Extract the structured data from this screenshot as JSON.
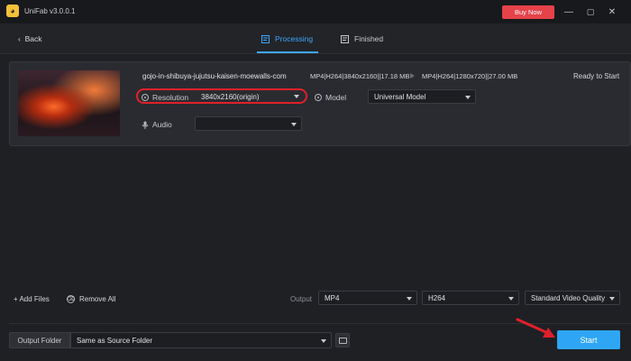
{
  "app": {
    "title": "UniFab v3.0.0.1",
    "buy_label": "Buy Now",
    "minimize": "—",
    "maximize": "▢",
    "close": "✕"
  },
  "nav": {
    "back_label": "Back",
    "tabs": [
      {
        "label": "Processing",
        "active": true
      },
      {
        "label": "Finished",
        "active": false
      }
    ]
  },
  "file": {
    "name": "gojo-in-shibuya-jujutsu-kaisen-moewalls-com",
    "input_spec": "MP4|H264|3840x2160||17.18 MB",
    "output_spec": "MP4|H264|1280x720||27.00 MB",
    "status": "Ready to Start",
    "resolution_label": "Resolution",
    "resolution_value": "3840x2160(origin)",
    "model_label": "Model",
    "model_value": "Universal Model",
    "audio_label": "Audio",
    "audio_value": ""
  },
  "bottom": {
    "add_files": "+ Add Files",
    "remove_all": "Remove All",
    "output_label": "Output",
    "format": "MP4",
    "codec": "H264",
    "quality": "Standard Video Quality",
    "output_folder_label": "Output Folder",
    "output_folder_value": "Same as Source Folder",
    "start_label": "Start"
  },
  "colors": {
    "accent": "#3ba7ff",
    "buy": "#e6424a",
    "highlight": "#e0202a",
    "start": "#2ea6f5"
  }
}
